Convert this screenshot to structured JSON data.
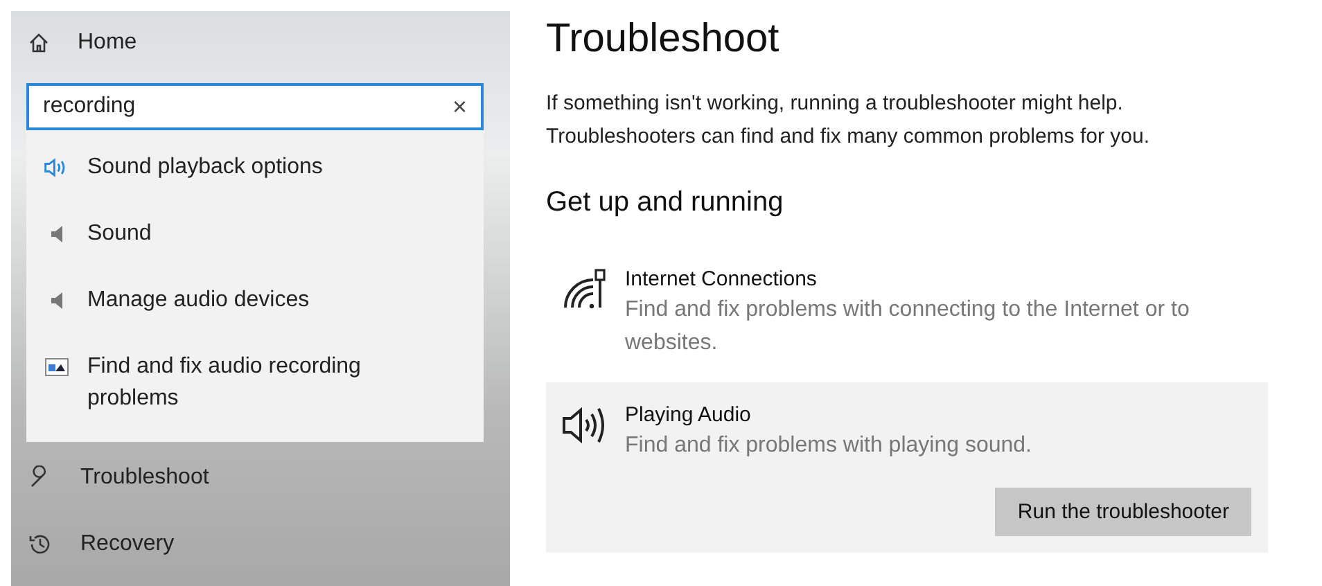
{
  "sidebar": {
    "home": {
      "label": "Home",
      "kind": "home"
    },
    "search": {
      "value": "recording",
      "clear": "×"
    },
    "results": [
      {
        "label": "Sound playback options",
        "kind": "playback"
      },
      {
        "label": "Sound",
        "kind": "sound"
      },
      {
        "label": "Manage audio devices",
        "kind": "sound"
      },
      {
        "label": "Find and fix audio recording problems",
        "kind": "troubleshooter"
      }
    ],
    "items": [
      {
        "label": "Troubleshoot",
        "kind": "troubleshoot"
      },
      {
        "label": "Recovery",
        "kind": "recovery"
      }
    ]
  },
  "main": {
    "title": "Troubleshoot",
    "intro": "If something isn't working, running a troubleshooter might help. Troubleshooters can find and fix many common problems for you.",
    "section": "Get up and running",
    "troubleshooters": [
      {
        "title": "Internet Connections",
        "description": "Find and fix problems with connecting to the Internet or to websites.",
        "kind": "network",
        "selected": false
      },
      {
        "title": "Playing Audio",
        "description": "Find and fix problems with playing sound.",
        "kind": "audio",
        "selected": true,
        "button": "Run the troubleshooter"
      }
    ]
  }
}
